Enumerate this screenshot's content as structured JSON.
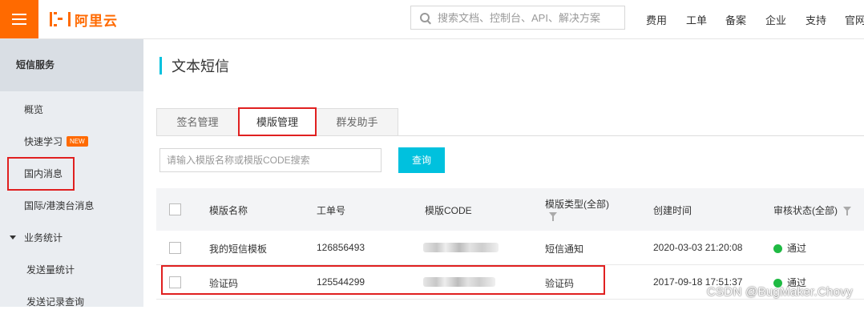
{
  "header": {
    "logo_text": "阿里云",
    "search_placeholder": "搜索文档、控制台、API、解决方案",
    "nav": [
      "费用",
      "工单",
      "备案",
      "企业",
      "支持",
      "官网"
    ]
  },
  "sidebar": {
    "title": "短信服务",
    "items": [
      {
        "label": "概览"
      },
      {
        "label": "快速学习",
        "badge": "NEW"
      },
      {
        "label": "国内消息"
      },
      {
        "label": "国际/港澳台消息"
      },
      {
        "label": "业务统计"
      },
      {
        "label": "发送量统计"
      },
      {
        "label": "发送记录查询"
      }
    ]
  },
  "main": {
    "title": "文本短信",
    "tabs": [
      {
        "label": "签名管理"
      },
      {
        "label": "模版管理"
      },
      {
        "label": "群发助手"
      }
    ],
    "filter": {
      "placeholder": "请输入模版名称或模版CODE搜索",
      "button": "查询"
    },
    "table": {
      "headers": [
        "模版名称",
        "工单号",
        "模版CODE",
        "模版类型(全部)",
        "创建时间",
        "审核状态(全部)"
      ],
      "rows": [
        {
          "name": "我的短信模板",
          "ticket": "126856493",
          "type": "短信通知",
          "created": "2020-03-03 21:20:08",
          "status": "通过"
        },
        {
          "name": "验证码",
          "ticket": "125544299",
          "type": "验证码",
          "created": "2017-09-18 17:51:37",
          "status": "通过"
        }
      ]
    }
  },
  "watermark": "CSDN @BugMaker.Chovy",
  "colors": {
    "brand": "#ff6a00",
    "accent": "#00c1de",
    "success": "#1fba43",
    "highlight": "#e02020"
  }
}
